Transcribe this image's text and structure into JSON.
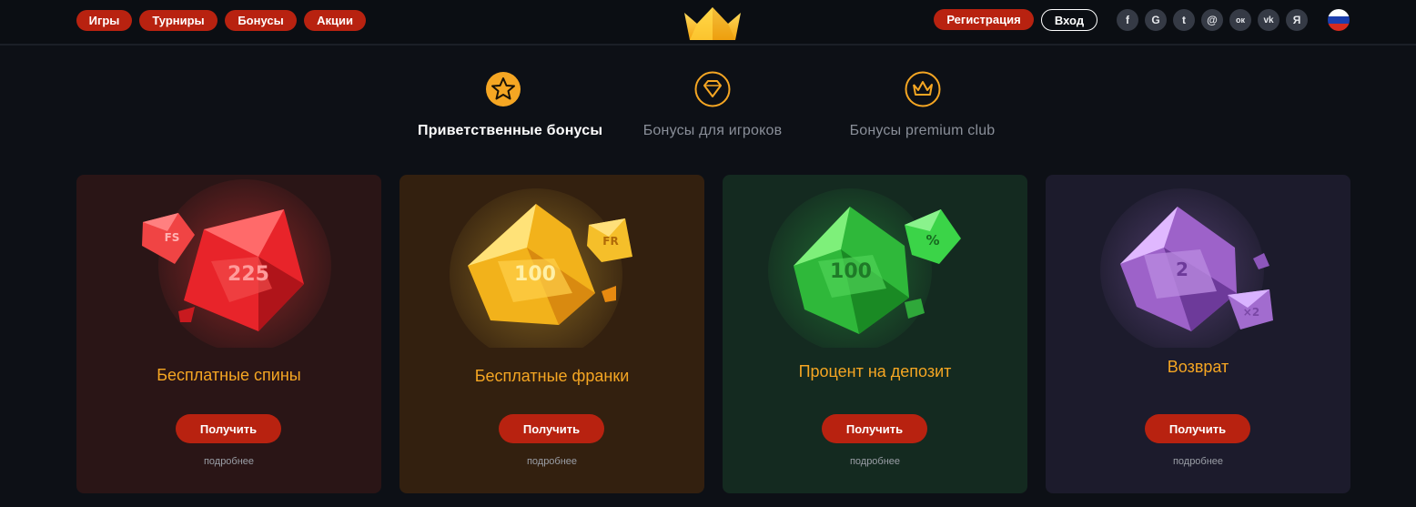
{
  "nav": {
    "items": [
      "Игры",
      "Турниры",
      "Бонусы",
      "Акции"
    ]
  },
  "auth": {
    "register_label": "Регистрация",
    "login_label": "Вход"
  },
  "social": [
    {
      "icon": "facebook-icon",
      "glyph": "f"
    },
    {
      "icon": "google-icon",
      "glyph": "G"
    },
    {
      "icon": "twitter-icon",
      "glyph": "t"
    },
    {
      "icon": "mail-ru-icon",
      "glyph": "@"
    },
    {
      "icon": "odnoklassniki-icon",
      "glyph": "ок"
    },
    {
      "icon": "vk-icon",
      "glyph": "vk"
    },
    {
      "icon": "yandex-icon",
      "glyph": "Я"
    }
  ],
  "tabs": [
    {
      "label": "Приветственные бонусы",
      "icon": "star-icon",
      "active": true
    },
    {
      "label": "Бонусы для игроков",
      "icon": "diamond-icon",
      "active": false
    },
    {
      "label": "Бонусы premium club",
      "icon": "crown-icon",
      "active": false
    }
  ],
  "cards": [
    {
      "title": "Бесплатные спины",
      "gem_main": "225",
      "gem_small": "FS",
      "button": "Получить",
      "more": "подробнее",
      "bg": "#2a1516",
      "gem_color": "#e8242a"
    },
    {
      "title": "Бесплатные франки",
      "gem_main": "100",
      "gem_small": "FR",
      "button": "Получить",
      "more": "подробнее",
      "bg": "#33200f",
      "gem_color": "#f2b21b"
    },
    {
      "title": "Процент на депозит",
      "gem_main": "100",
      "gem_small": "%",
      "button": "Получить",
      "more": "подробнее",
      "bg": "#142a20",
      "gem_color": "#2fb83a"
    },
    {
      "title": "Возврат",
      "gem_main": "2",
      "gem_small": "×2",
      "button": "Получить",
      "more": "подробнее",
      "bg": "#1c1b2c",
      "gem_color": "#9d62c9"
    }
  ],
  "colors": {
    "accent": "#b82210",
    "title_gold": "#f5a623",
    "tab_icon": "#f5a623"
  }
}
